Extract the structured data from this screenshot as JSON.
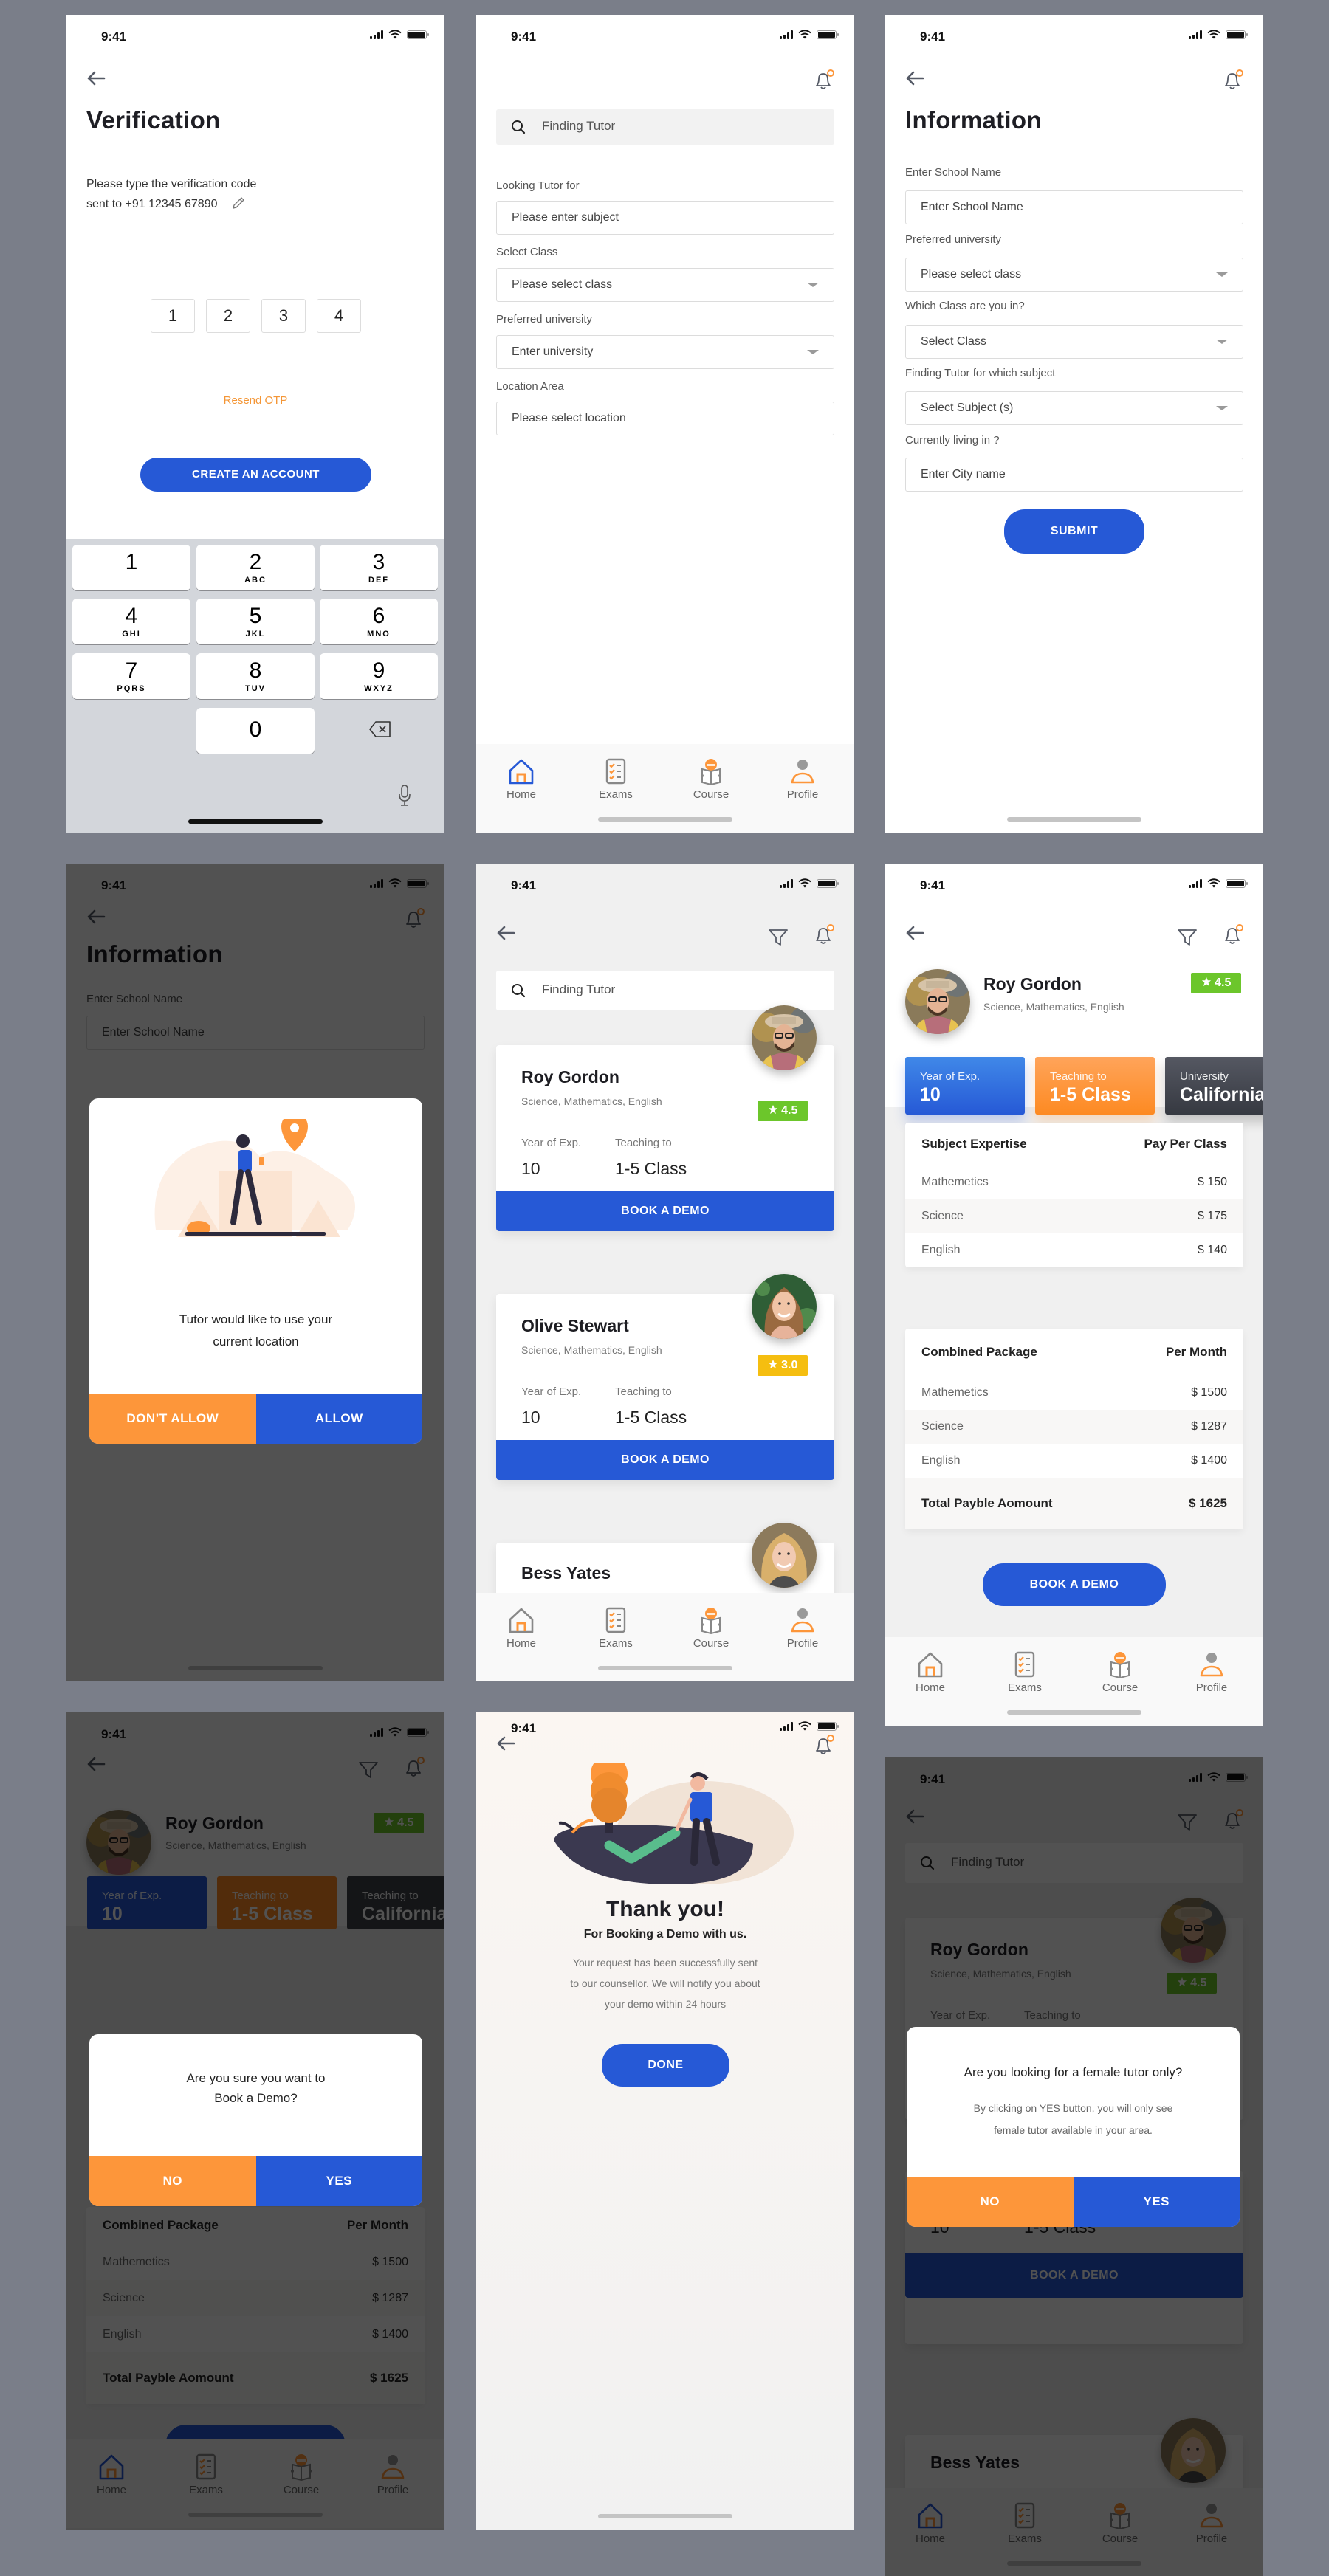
{
  "common": {
    "time": "9:41",
    "nav": [
      {
        "label": "Home",
        "icon": "home-icon"
      },
      {
        "label": "Exams",
        "icon": "checklist-icon"
      },
      {
        "label": "Course",
        "icon": "course-reader-icon"
      },
      {
        "label": "Profile",
        "icon": "profile-icon"
      }
    ],
    "colors": {
      "primary": "#2659d6",
      "accent": "#fd963a",
      "rating_green": "#6cc62b",
      "rating_yellow": "#f5be10",
      "page_bg": "#7a7e89"
    }
  },
  "verification": {
    "title": "Verification",
    "instruction_line1": "Please type the verification code",
    "instruction_line2": "sent to +91 12345 67890",
    "otp": [
      "1",
      "2",
      "3",
      "4"
    ],
    "resend": "Resend OTP",
    "create_button": "CREATE AN ACCOUNT",
    "keys": [
      {
        "n": "1",
        "l": ""
      },
      {
        "n": "2",
        "l": "ABC"
      },
      {
        "n": "3",
        "l": "DEF"
      },
      {
        "n": "4",
        "l": "GHI"
      },
      {
        "n": "5",
        "l": "JKL"
      },
      {
        "n": "6",
        "l": "MNO"
      },
      {
        "n": "7",
        "l": "PQRS"
      },
      {
        "n": "8",
        "l": "TUV"
      },
      {
        "n": "9",
        "l": "WXYZ"
      },
      {
        "n": "0",
        "l": ""
      }
    ]
  },
  "find_tutor": {
    "search_placeholder": "Finding Tutor",
    "fields": [
      {
        "label": "Looking Tutor for",
        "placeholder": "Please enter subject",
        "dropdown": false
      },
      {
        "label": "Select Class",
        "placeholder": "Please select class",
        "dropdown": true
      },
      {
        "label": "Preferred university",
        "placeholder": "Enter university",
        "dropdown": true
      },
      {
        "label": "Location Area",
        "placeholder": "Please select location",
        "dropdown": false
      }
    ]
  },
  "information": {
    "title": "Information",
    "fields": [
      {
        "label": "Enter School Name",
        "placeholder": "Enter School Name",
        "dropdown": false
      },
      {
        "label": "Preferred university",
        "placeholder": "Please select class",
        "dropdown": true
      },
      {
        "label": "Which Class are you in?",
        "placeholder": "Select Class",
        "dropdown": true
      },
      {
        "label": "Finding Tutor for which subject",
        "placeholder": "Select Subject (s)",
        "dropdown": true
      },
      {
        "label": "Currently living in ?",
        "placeholder": "Enter City name",
        "dropdown": false
      }
    ],
    "submit": "SUBMIT"
  },
  "location_dialog": {
    "message_line1": "Tutor would like to use your",
    "message_line2": "current location",
    "deny": "DON’T ALLOW",
    "allow": "ALLOW"
  },
  "tutor_list": {
    "search_placeholder": "Finding Tutor",
    "exp_label": "Year of Exp.",
    "teaching_label": "Teaching  to",
    "book_label": "BOOK A DEMO",
    "tutors": [
      {
        "name": "Roy Gordon",
        "subjects": "Science, Mathematics, English",
        "rating": "4.5",
        "experience": "10",
        "teaching": "1-5 Class"
      },
      {
        "name": "Olive Stewart",
        "subjects": "Science, Mathematics, English",
        "rating": "3.0",
        "experience": "10",
        "teaching": "1-5 Class"
      },
      {
        "name": "Bess Yates"
      }
    ]
  },
  "profile": {
    "name": "Roy Gordon",
    "subjects": "Science, Mathematics, English",
    "rating": "4.5",
    "stats": [
      {
        "label": "Year of Exp.",
        "value": "10"
      },
      {
        "label": "Teaching to",
        "value": "1-5 Class"
      },
      {
        "label": "University",
        "value": "California"
      }
    ],
    "expertise": {
      "header_left": "Subject Expertise",
      "header_right": "Pay Per Class",
      "rows": [
        {
          "subject": "Mathemetics",
          "price": "$ 150"
        },
        {
          "subject": "Science",
          "price": "$ 175"
        },
        {
          "subject": "English",
          "price": "$ 140"
        }
      ]
    },
    "package": {
      "header_left": "Combined Package",
      "header_right": "Per Month",
      "rows": [
        {
          "subject": "Mathemetics",
          "price": "$ 1500"
        },
        {
          "subject": "Science",
          "price": "$ 1287"
        },
        {
          "subject": "English",
          "price": "$ 1400"
        }
      ],
      "total_label": "Total Payble Aomount",
      "total_value": "$ 1625"
    },
    "book_label": "BOOK A DEMO"
  },
  "confirm_dialog": {
    "message_line1": "Are you sure you want to",
    "message_line2": "Book a Demo?",
    "no": "NO",
    "yes": "YES",
    "bg_third_stat_label": "Teaching to"
  },
  "thank_you": {
    "title": "Thank you!",
    "subtitle": "For Booking a Demo with us.",
    "body_line1": "Your request has been successfully sent",
    "body_line2": "to our counsellor. We will notify you about",
    "body_line3": "your demo within 24 hours",
    "done": "DONE"
  },
  "female_dialog": {
    "question": "Are you looking for a female tutor only?",
    "body_line1": "By clicking on YES button, you will only see",
    "body_line2": "female tutor available in your area.",
    "no": "NO",
    "yes": "YES"
  }
}
